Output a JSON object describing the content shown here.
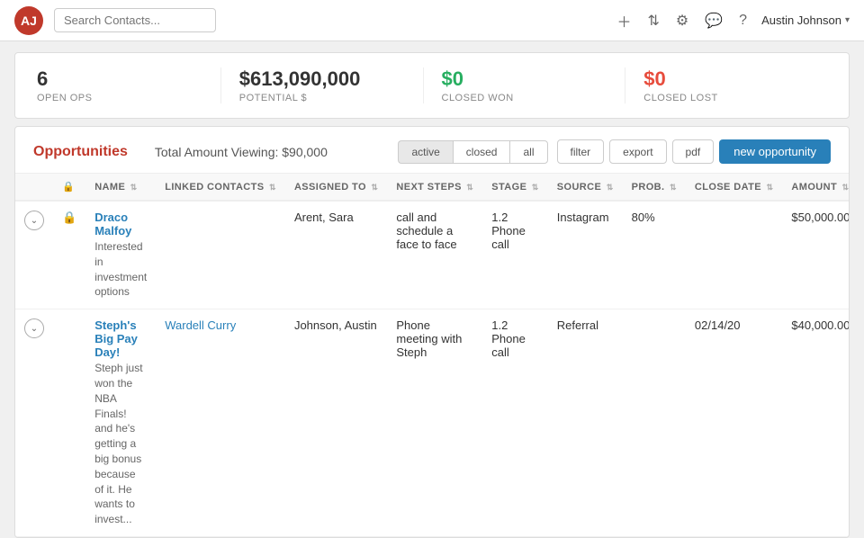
{
  "app": {
    "logo_text": "AJ"
  },
  "topnav": {
    "search_placeholder": "Search Contacts...",
    "user_name": "Austin Johnson",
    "icons": [
      "plus",
      "share",
      "filter",
      "chat",
      "help"
    ]
  },
  "stats": {
    "open_ops": {
      "value": "6",
      "label": "OPEN OPS"
    },
    "potential": {
      "value": "$613,090,000",
      "label": "POTENTIAL $"
    },
    "closed_won": {
      "value": "$0",
      "label": "CLOSED WON"
    },
    "closed_lost": {
      "value": "$0",
      "label": "CLOSED LOST"
    }
  },
  "panel": {
    "title": "Opportunities",
    "subtitle": "Total Amount Viewing: $90,000",
    "filter_buttons": [
      "active",
      "closed",
      "all"
    ],
    "active_filter": "active",
    "action_buttons": [
      "filter",
      "export",
      "pdf"
    ],
    "new_button": "new opportunity"
  },
  "table": {
    "columns": [
      "",
      "",
      "NAME",
      "LINKED CONTACTS",
      "ASSIGNED TO",
      "NEXT STEPS",
      "STAGE",
      "SOURCE",
      "PROB.",
      "CLOSE DATE",
      "AMOUNT"
    ],
    "rows": [
      {
        "id": 1,
        "expand": "v",
        "locked": true,
        "name": "Draco Malfoy",
        "description": "Interested in investment options",
        "linked_contacts": "",
        "assigned_to": "Arent, Sara",
        "next_steps": "call and schedule a face to face",
        "stage": "1.2 Phone call",
        "source": "Instagram",
        "prob": "80%",
        "close_date": "",
        "amount": "$50,000.00"
      },
      {
        "id": 2,
        "expand": "v",
        "locked": false,
        "name": "Steph's Big Pay Day!",
        "description": "Steph just won the NBA Finals! and he's getting a big bonus because of it. He wants to invest...",
        "linked_contacts": "Wardell Curry",
        "assigned_to": "Johnson, Austin",
        "next_steps": "Phone meeting with Steph",
        "stage": "1.2 Phone call",
        "source": "Referral",
        "prob": "",
        "close_date": "02/14/20",
        "amount": "$40,000.00"
      }
    ]
  }
}
